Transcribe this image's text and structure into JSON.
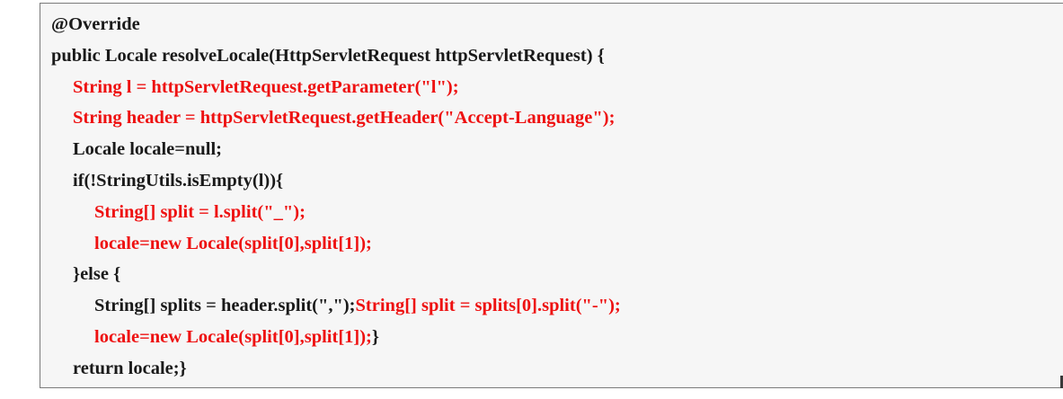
{
  "code": {
    "line1": "@Override",
    "line2": "public Locale resolveLocale(HttpServletRequest httpServletRequest) {",
    "line3": "String l = httpServletRequest.getParameter(\"l\");",
    "line4": "String header = httpServletRequest.getHeader(\"Accept-Language\");",
    "line5": "Locale locale=null;",
    "line6": "if(!StringUtils.isEmpty(l)){",
    "line7": "String[] split = l.split(\"_\");",
    "line8": "locale=new Locale(split[0],split[1]);",
    "line9": "}else {",
    "line10a": "String[] splits = header.split(\",\");",
    "line10b": "String[] split = splits[0].split(\"-\");",
    "line11a": "locale=new Locale(split[0],split[1]);",
    "line11b": "}",
    "line12": "return locale;}"
  },
  "colors": {
    "highlight": "#ee1111",
    "text": "#1a1a1a",
    "background": "#f6f6f6",
    "border": "#7a7a7a"
  }
}
